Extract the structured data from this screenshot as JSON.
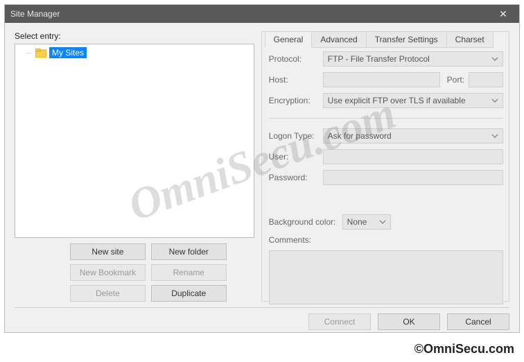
{
  "titlebar": {
    "title": "Site Manager"
  },
  "left": {
    "select_label": "Select entry:",
    "tree_root": "My Sites",
    "buttons": {
      "new_site": "New site",
      "new_folder": "New folder",
      "new_bookmark": "New Bookmark",
      "rename": "Rename",
      "delete": "Delete",
      "duplicate": "Duplicate"
    }
  },
  "tabs": {
    "general": "General",
    "advanced": "Advanced",
    "transfer": "Transfer Settings",
    "charset": "Charset"
  },
  "form": {
    "protocol_label": "Protocol:",
    "protocol_value": "FTP - File Transfer Protocol",
    "host_label": "Host:",
    "host_value": "",
    "port_label": "Port:",
    "port_value": "",
    "encryption_label": "Encryption:",
    "encryption_value": "Use explicit FTP over TLS if available",
    "logon_label": "Logon Type:",
    "logon_value": "Ask for password",
    "user_label": "User:",
    "user_value": "",
    "password_label": "Password:",
    "password_value": "",
    "bgcolor_label": "Background color:",
    "bgcolor_value": "None",
    "comments_label": "Comments:",
    "comments_value": ""
  },
  "footer": {
    "connect": "Connect",
    "ok": "OK",
    "cancel": "Cancel"
  },
  "watermark": "OmniSecu.com",
  "copyright": "©OmniSecu.com"
}
